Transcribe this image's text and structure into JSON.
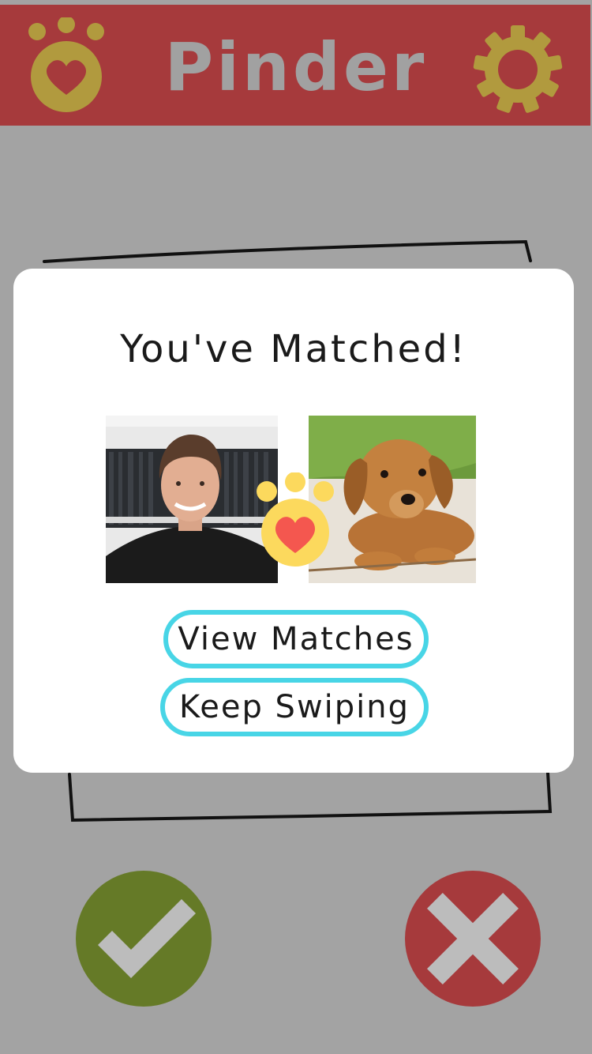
{
  "header": {
    "app_title": "Pinder",
    "logo_icon": "paw-heart-icon",
    "settings_icon": "gear-icon"
  },
  "match_modal": {
    "title": "You've Matched!",
    "user_photo": "person-photo",
    "pet_photo": "puppy-photo",
    "match_icon": "paw-heart-icon",
    "view_matches_label": "View Matches",
    "keep_swiping_label": "Keep Swiping"
  },
  "actions": {
    "accept_icon": "checkmark-icon",
    "reject_icon": "x-icon"
  },
  "colors": {
    "brand_red": "#a63a3c",
    "gold": "#b19a3e",
    "grey_background": "#a3a3a3",
    "accent_cyan": "#48d5e6",
    "accept_green": "#657a27",
    "match_yellow": "#fcd95d",
    "heart_red": "#f4574f"
  }
}
